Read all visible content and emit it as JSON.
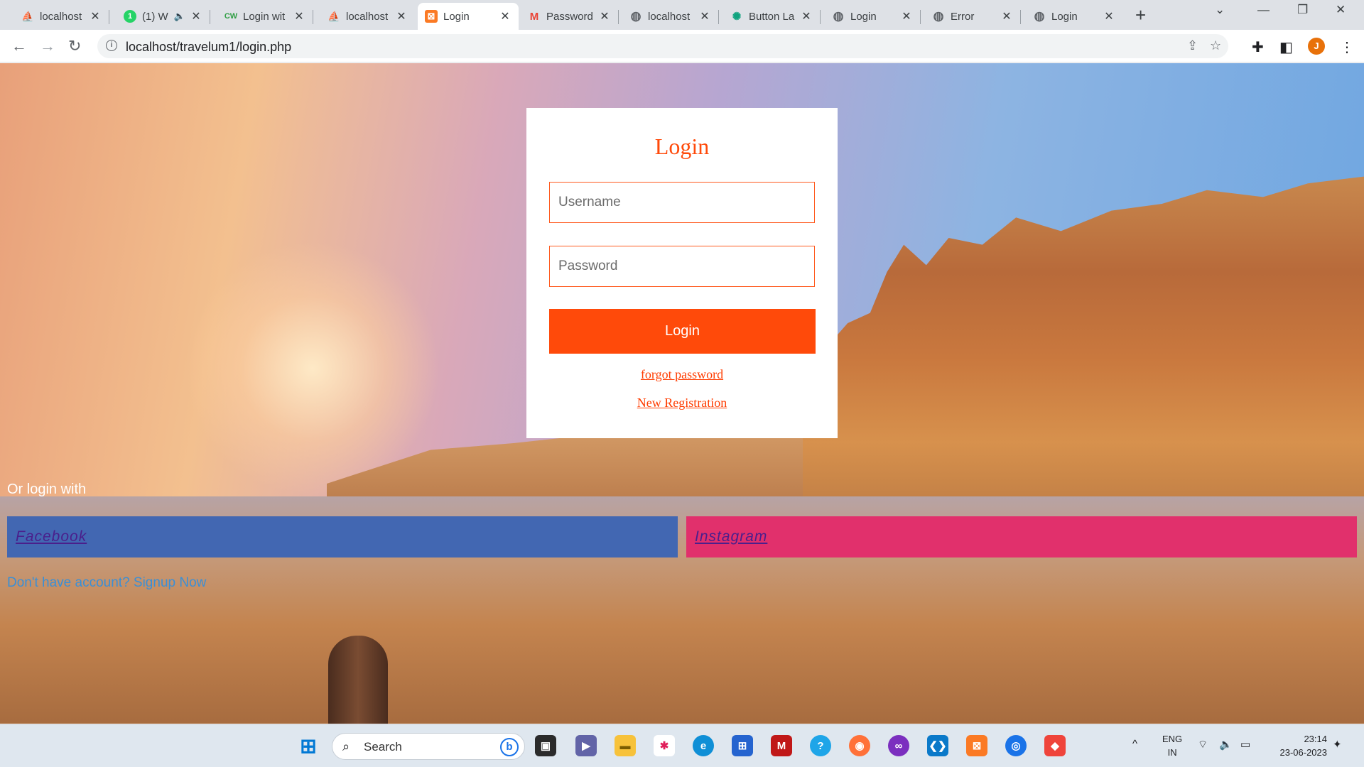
{
  "browser": {
    "tabs": [
      {
        "title": "localhost",
        "favicon": "phpmyadmin-icon",
        "color": "#f89c0e",
        "glyph": "⛵"
      },
      {
        "title": "(1) W",
        "favicon": "whatsapp-icon",
        "color": "#25d366",
        "glyph": "1",
        "muted": "🔈"
      },
      {
        "title": "Login wit",
        "favicon": "cw-icon",
        "color": "#2f9e44",
        "glyph": "CW"
      },
      {
        "title": "localhost",
        "favicon": "phpmyadmin-icon",
        "color": "#f89c0e",
        "glyph": "⛵"
      },
      {
        "title": "Login",
        "favicon": "xampp-icon",
        "color": "#fb7a24",
        "glyph": "⊠"
      },
      {
        "title": "Password",
        "favicon": "gmail-icon",
        "color": "#ea4335",
        "glyph": "M"
      },
      {
        "title": "localhost",
        "favicon": "globe-icon",
        "color": "#5f6368",
        "glyph": "◍"
      },
      {
        "title": "Button La",
        "favicon": "chatgpt-icon",
        "color": "#10a37f",
        "glyph": "✺"
      },
      {
        "title": "Login",
        "favicon": "globe-icon",
        "color": "#5f6368",
        "glyph": "◍"
      },
      {
        "title": "Error",
        "favicon": "globe-icon",
        "color": "#5f6368",
        "glyph": "◍"
      },
      {
        "title": "Login",
        "favicon": "globe-icon",
        "color": "#5f6368",
        "glyph": "◍"
      }
    ],
    "close_glyph": "✕",
    "newtab_glyph": "+",
    "url": "localhost/travelum1/login.php",
    "profile_initial": "J"
  },
  "login": {
    "title": "Login",
    "username_placeholder": "Username",
    "password_placeholder": "Password",
    "submit_label": "Login",
    "forgot_label": "forgot password",
    "register_label": "New Registration",
    "accent": "#ff4a0a"
  },
  "social": {
    "heading": "Or login with",
    "facebook_label": "Facebook",
    "instagram_label": "Instagram",
    "facebook_color": "#4267b2",
    "instagram_color": "#e1306c",
    "signup_text": "Don't have account? Signup Now"
  },
  "taskbar": {
    "search_label": "Search",
    "lang_line1": "ENG",
    "lang_line2": "IN",
    "time": "23:14",
    "date": "23-06-2023"
  }
}
